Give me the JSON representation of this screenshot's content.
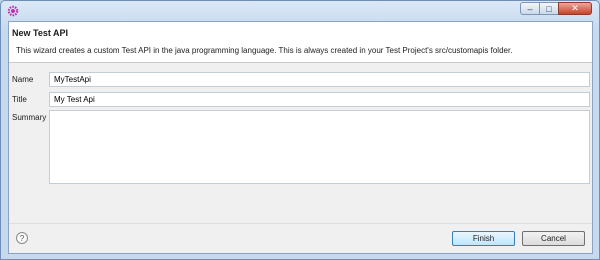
{
  "wizard": {
    "title": "New Test API",
    "description": "This wizard creates a custom Test API in the java programming language.  This is always created in your Test Project's src/customapis folder."
  },
  "fields": {
    "name_label": "Name",
    "name_value": "MyTestApi",
    "title_label": "Title",
    "title_value": "My Test Api",
    "summary_label": "Summary",
    "summary_value": ""
  },
  "buttons": {
    "finish": "Finish",
    "cancel": "Cancel",
    "help": "?"
  },
  "window_controls": {
    "minimize": "–",
    "maximize": "□",
    "close": "✕"
  },
  "icons": {
    "app": "gear-icon",
    "help": "help-icon"
  },
  "colors": {
    "app_icon": "#c02fb0",
    "default_button": "#3c7fb1"
  }
}
